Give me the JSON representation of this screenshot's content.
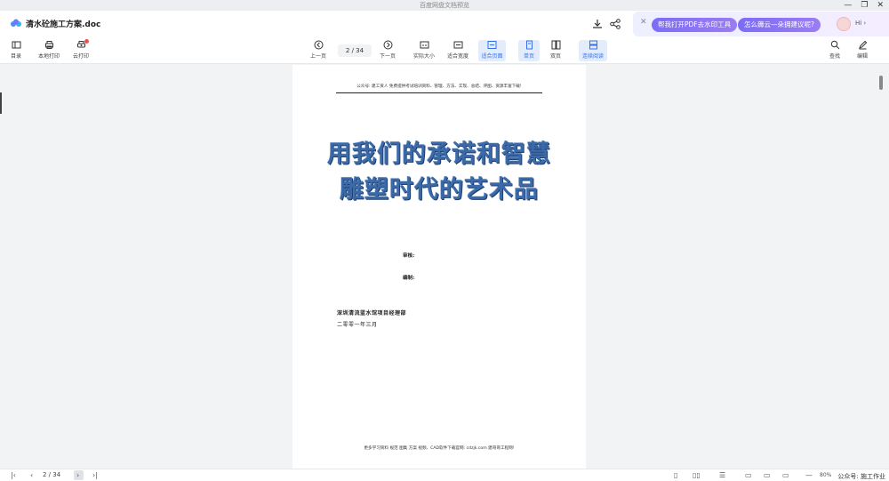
{
  "window": {
    "title": "百度网盘文档预览"
  },
  "header": {
    "file_name": "清水砼施工方案.doc",
    "ad": {
      "pill1": "帮我打开PDF去水印工具",
      "pill2": "怎么薅云—朵拥建议呢?",
      "hi": "Hi ›"
    }
  },
  "toolbar": {
    "contents": "目录",
    "local_print": "本地打印",
    "cloud_print": "云打印",
    "prev_page": "上一页",
    "page_indicator": "2  /  34",
    "next_page": "下一页",
    "actual_size": "实际大小",
    "fit_width": "适合宽度",
    "fit_page": "适合页面",
    "single_page": "单页",
    "double_page": "双页",
    "continuous": "连续阅读",
    "find": "查找",
    "edit": "编辑"
  },
  "document": {
    "header_text": "公众号: 建工资人 免费提供考试培训资料、管理、方法、实现、总结、评图、资源丰富下载!",
    "title_line1": "用我们的承诺和智慧",
    "title_line2": "雕塑时代的艺术品",
    "reviewer_label": "审核:",
    "editor_label": "编制:",
    "company": "深圳清流蓝水馆项目经理部",
    "date": "二零零一年三月",
    "footer_text": "更多学习资料 规范 图集 方案 视频、CAD软件下载官网: cdzjk.com 建哥哥工程网!"
  },
  "statusbar": {
    "page_indicator": "2  /  34",
    "zoom": "80%",
    "watermark": "公众号: 施工作业"
  },
  "colors": {
    "accent": "#3570e8",
    "wordart": "#3c6aa8",
    "ad_pill": "#7c6cf6"
  }
}
